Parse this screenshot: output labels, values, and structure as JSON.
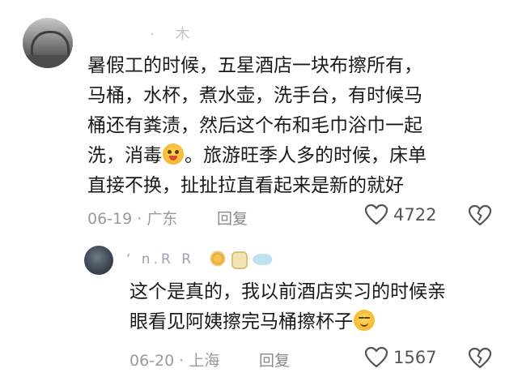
{
  "comments": [
    {
      "username": "· 木",
      "text_lines": [
        "暑假工的时候，五星酒店一块布擦所有，",
        "马桶，水杯，煮水壶，洗手台，有时候马",
        "桶还有粪渍，然后这个布和毛巾浴巾一起",
        "洗，消毒",
        "。旅游旺季人多的时候，床单",
        "直接不换，扯扯拉直看起来是新的就好"
      ],
      "date_location": "06-19 · 广东",
      "reply_label": "回复",
      "like_count": "4722",
      "emoji": "winking-tongue-face"
    },
    {
      "username": "‘ n.R R",
      "text_lines": [
        "这个是真的，我以前酒店实习的时候亲",
        "眼看见阿姨擦完马桶擦杯子"
      ],
      "date_location": "06-20 · 上海",
      "reply_label": "回复",
      "like_count": "1567",
      "emoji": "smirk-face"
    }
  ],
  "colors": {
    "text": "#1a1a1a",
    "meta": "#9a9a9a",
    "icon": "#555555"
  }
}
